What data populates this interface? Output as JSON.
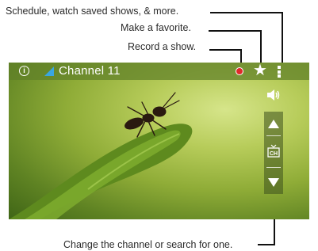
{
  "callouts": {
    "menu": "Schedule, watch saved shows, & more.",
    "favorite": "Make a favorite.",
    "record": "Record a show.",
    "channel": "Change the channel or search for one."
  },
  "screen": {
    "channel_title": "Channel 11",
    "guide_label": "CH",
    "icons": [
      "info-icon",
      "signal-icon",
      "record-icon",
      "star-icon",
      "menu-icon",
      "volume-icon",
      "chevron-up-icon",
      "tv-guide-icon",
      "chevron-down-icon"
    ]
  },
  "colors": {
    "record": "#e02a2a",
    "status_bar": "#60802a",
    "signal": "#3aa6e0"
  }
}
